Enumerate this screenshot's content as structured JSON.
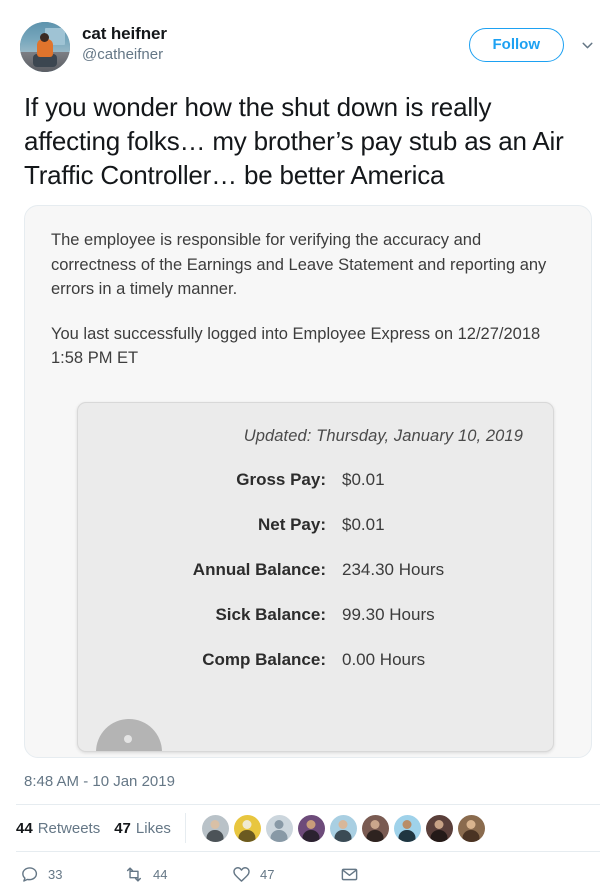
{
  "account": {
    "display_name": "cat heifner",
    "handle": "@catheifner",
    "avatar_icon": "profile-photo",
    "follow_label": "Follow",
    "caret_icon": "chevron-down-icon"
  },
  "tweet": {
    "text": "If you wonder how the shut down is really affecting folks… my brother’s pay stub as an Air Traffic Controller… be better America",
    "timestamp": "8:48 AM - 10 Jan 2019"
  },
  "media": {
    "alt": "employee-express-pay-stub-screenshot",
    "disclaimer": "The employee is responsible for verifying the accuracy and correctness of the Earnings and Leave Statement and reporting any errors in a timely manner.",
    "last_login": "You last successfully logged into Employee Express on 12/27/2018 1:58 PM ET",
    "updated": "Updated: Thursday, January 10, 2019",
    "rows": [
      {
        "label": "Gross Pay:",
        "value": "$0.01"
      },
      {
        "label": "Net Pay:",
        "value": "$0.01"
      },
      {
        "label": "Annual Balance:",
        "value": "234.30 Hours"
      },
      {
        "label": "Sick Balance:",
        "value": "99.30 Hours"
      },
      {
        "label": "Comp Balance:",
        "value": "0.00 Hours"
      }
    ]
  },
  "stats": {
    "retweets_count": "44",
    "retweets_label": "Retweets",
    "likes_count": "47",
    "likes_label": "Likes",
    "facepile": [
      {
        "name": "liker-avatar-1",
        "bg": "#b9c2c8",
        "body": "#4c5358",
        "head": "#d9c0a6"
      },
      {
        "name": "liker-avatar-2",
        "bg": "#e8c63f",
        "body": "#6b5a20",
        "head": "#f0ead0"
      },
      {
        "name": "liker-avatar-3",
        "bg": "#ccd6dd",
        "body": "#8899a6",
        "head": "#8899a6"
      },
      {
        "name": "liker-avatar-4",
        "bg": "#6d4b7a",
        "body": "#2b2230",
        "head": "#c99d7a"
      },
      {
        "name": "liker-avatar-5",
        "bg": "#a9cfe2",
        "body": "#3b4b55",
        "head": "#d8b79a"
      },
      {
        "name": "liker-avatar-6",
        "bg": "#7a5b52",
        "body": "#2e2320",
        "head": "#caa68c"
      },
      {
        "name": "liker-avatar-7",
        "bg": "#9fd2ea",
        "body": "#1f3540",
        "head": "#b98d68"
      },
      {
        "name": "liker-avatar-8",
        "bg": "#5a3f3a",
        "body": "#241a18",
        "head": "#c8a286"
      },
      {
        "name": "liker-avatar-9",
        "bg": "#8a6b4e",
        "body": "#4a3323",
        "head": "#d9b48e"
      }
    ]
  },
  "actions": {
    "reply": {
      "icon": "reply-icon",
      "count": "33"
    },
    "retweet": {
      "icon": "retweet-icon",
      "count": "44"
    },
    "like": {
      "icon": "heart-icon",
      "count": "47"
    },
    "share": {
      "icon": "envelope-icon",
      "count": ""
    }
  },
  "colors": {
    "brand_blue": "#1da1f2",
    "text_dark": "#14171a",
    "text_muted": "#657786",
    "border": "#e6ecf0"
  }
}
